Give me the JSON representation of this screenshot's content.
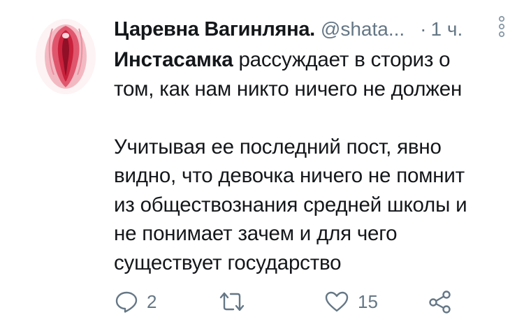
{
  "tweet": {
    "author_name": "Царевна Вагинляна.",
    "handle": "@shata...",
    "separator": "·",
    "time": "1 ч.",
    "body": {
      "mention": "Инстасамка",
      "line1_rest": " рассуждает в сториз о",
      "line2": "том, как нам никто ничего не должен",
      "para2_lines": [
        "Учитывая ее последний пост, явно",
        "видно, что девочка ничего не помнит",
        "из обществознания средней школы и",
        "не понимает зачем и для чего",
        "существует государство"
      ]
    }
  },
  "actions": {
    "reply_count": "2",
    "retweet_count": "",
    "like_count": "15"
  },
  "colors": {
    "text": "#14171a",
    "muted": "#657786",
    "avatar_red": "#d6304a"
  },
  "icons": [
    "more-icon",
    "reply-icon",
    "retweet-icon",
    "like-icon",
    "share-icon"
  ]
}
